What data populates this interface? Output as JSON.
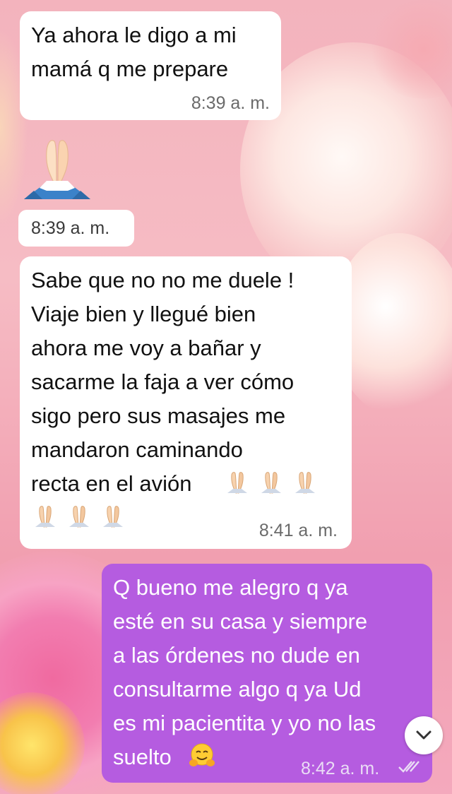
{
  "chat": {
    "messages": [
      {
        "direction": "incoming",
        "text": "Ya ahora le digo a mi\nmamá q me prepare",
        "time": "8:39 a. m."
      },
      {
        "direction": "incoming",
        "emoji": "folded-hands",
        "time": "8:39 a. m."
      },
      {
        "direction": "incoming",
        "text": "Sabe que no no me duele !\nViaje bien y llegué bien\nahora me voy a bañar y\nsacarme la faja a ver cómo\nsigo pero sus masajes me\nmandaron caminando\nrecta en el avión",
        "trailing_emoji": "folded-hands x6",
        "time": "8:41 a. m."
      },
      {
        "direction": "outgoing",
        "text": "Q bueno me alegro q ya\nesté en su casa y siempre\na las órdenes no dude en\nconsultarme algo q ya Ud\nes mi pacientita y yo no las\nsuelto",
        "trailing_emoji": "hugging-face",
        "time": "8:42 a. m.",
        "status": "read"
      }
    ]
  },
  "colors": {
    "incoming_bubble": "#ffffff",
    "outgoing_bubble": "#b55ce0",
    "wallpaper": "#f6bcc4"
  },
  "icons": {
    "scroll_down": "chevron-down-icon",
    "read_receipt": "double-check-icon"
  }
}
